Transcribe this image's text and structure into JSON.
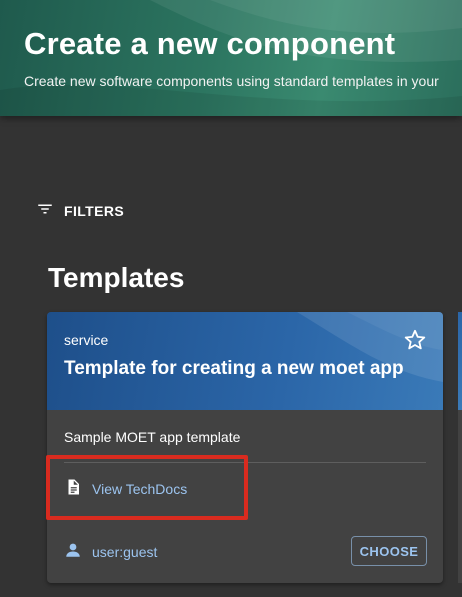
{
  "header": {
    "title": "Create a new component",
    "subtitle": "Create new software components using standard templates in your"
  },
  "filters": {
    "label": "FILTERS",
    "icon": "filter-list-icon"
  },
  "section": {
    "title": "Templates"
  },
  "card": {
    "type": "service",
    "title": "Template for creating a new moet app",
    "description": "Sample MOET app template",
    "techdocs_label": "View TechDocs",
    "techdocs_icon": "document-icon",
    "owner": "user:guest",
    "owner_icon": "person-icon",
    "choose_label": "CHOOSE",
    "star_icon": "star-outline-icon"
  },
  "colors": {
    "background": "#333333",
    "header_green": "#2c7560",
    "card_blue": "#2b66a8",
    "link": "#9cc4ef",
    "highlight": "#d92b1f"
  }
}
